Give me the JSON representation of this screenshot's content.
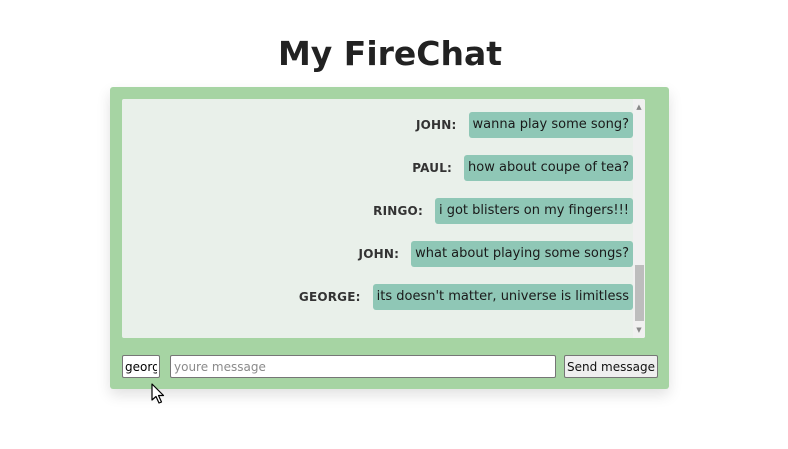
{
  "app": {
    "title": "My FireChat"
  },
  "messages": [
    {
      "author": "JOHN:",
      "text": "wanna play some song?"
    },
    {
      "author": "PAUL:",
      "text": "how about coupe of tea?"
    },
    {
      "author": "RINGO:",
      "text": "i got blisters on my fingers!!!"
    },
    {
      "author": "JOHN:",
      "text": "what about playing some songs?"
    },
    {
      "author": "GEORGE:",
      "text": "its doesn't matter, universe is limitless"
    }
  ],
  "composer": {
    "name_value": "georg",
    "message_placeholder": "youre message",
    "message_value": "",
    "send_label": "Send message"
  },
  "scrollbar": {
    "up_glyph": "▲",
    "down_glyph": "▼"
  },
  "colors": {
    "card_background": "#a6d4a3",
    "panel_background": "#e9f0ea",
    "bubble_background": "#8fc7b6"
  }
}
